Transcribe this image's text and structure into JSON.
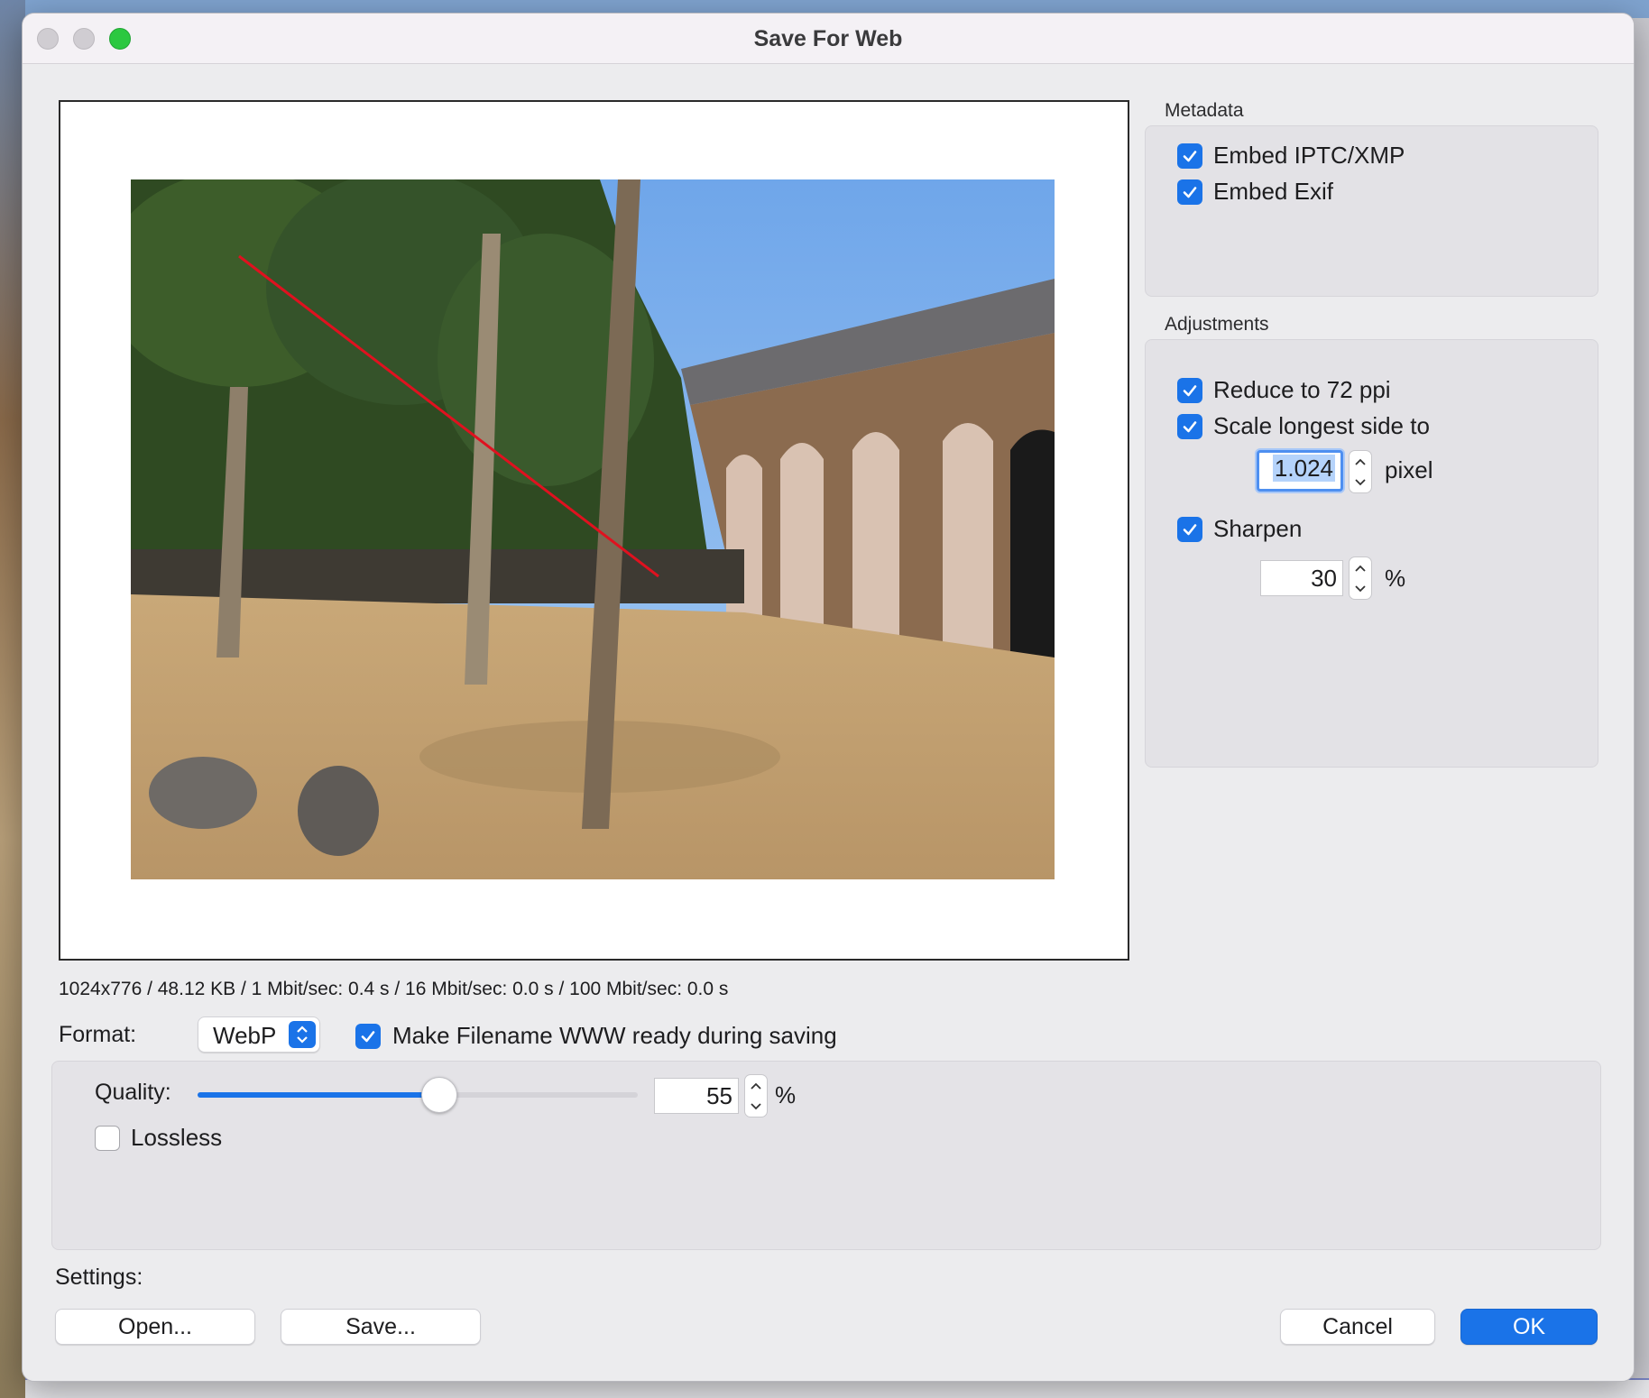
{
  "window": {
    "title": "Save For Web"
  },
  "preview": {
    "file_info": "1024x776 / 48.12 KB / 1 Mbit/sec: 0.4 s / 16 Mbit/sec: 0.0 s / 100 Mbit/sec: 0.0 s"
  },
  "metadata": {
    "heading": "Metadata",
    "embed_iptc": {
      "label": "Embed IPTC/XMP",
      "checked": true
    },
    "embed_exif": {
      "label": "Embed Exif",
      "checked": true
    }
  },
  "adjustments": {
    "heading": "Adjustments",
    "reduce_ppi": {
      "label": "Reduce to 72 ppi",
      "checked": true
    },
    "scale_longest": {
      "label": "Scale longest side to",
      "checked": true,
      "value": "1.024",
      "unit": "pixel"
    },
    "sharpen": {
      "label": "Sharpen",
      "checked": true,
      "value": "30",
      "unit": "%"
    }
  },
  "format": {
    "label": "Format:",
    "selected": "WebP",
    "www_ready": {
      "label": "Make Filename WWW ready during saving",
      "checked": true
    }
  },
  "quality": {
    "label": "Quality:",
    "value": "55",
    "fraction": 0.55,
    "unit": "%"
  },
  "lossless": {
    "label": "Lossless",
    "checked": false
  },
  "settings": {
    "label": "Settings:",
    "open_label": "Open...",
    "save_label": "Save..."
  },
  "actions": {
    "cancel_label": "Cancel",
    "ok_label": "OK"
  },
  "colors": {
    "accent": "#1a73e8",
    "zoom_button": "#2bc840"
  },
  "icons": [
    "checkmark-icon",
    "chevron-up-icon",
    "chevron-down-icon",
    "select-arrows-icon"
  ]
}
